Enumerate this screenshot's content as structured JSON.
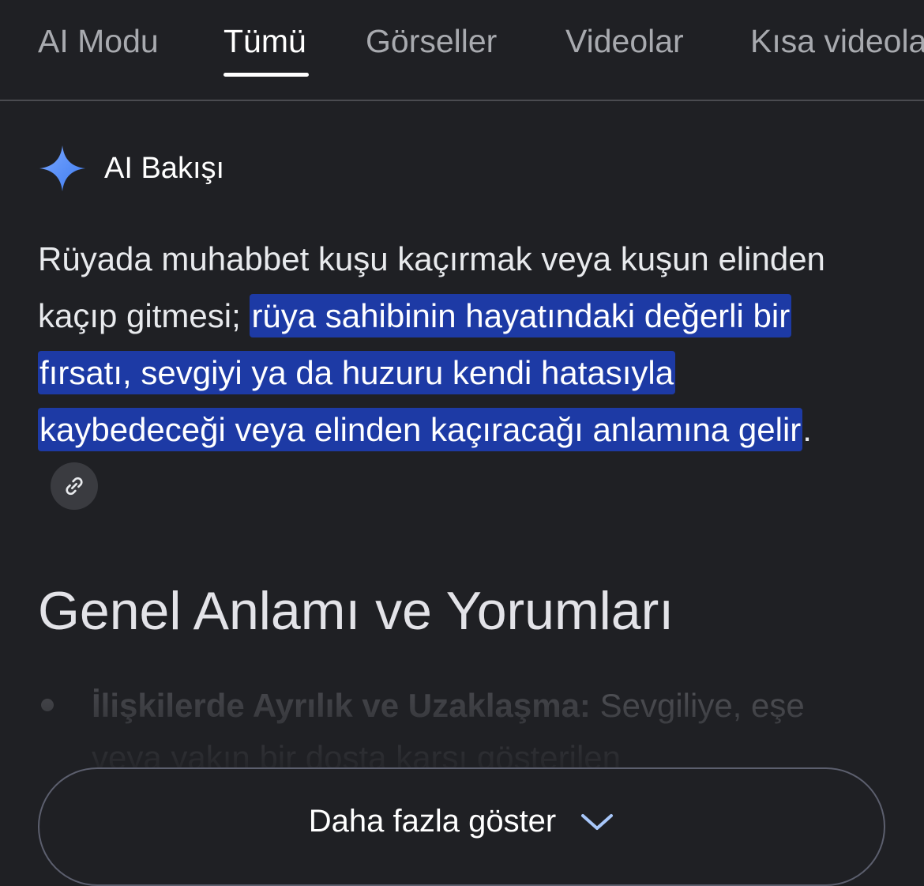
{
  "tabs": [
    {
      "label": "AI Modu",
      "active": false
    },
    {
      "label": "Tümü",
      "active": true
    },
    {
      "label": "Görseller",
      "active": false
    },
    {
      "label": "Videolar",
      "active": false
    },
    {
      "label": "Kısa videolar",
      "active": false
    }
  ],
  "ai_overview": {
    "title": "AI Bakışı",
    "icon": "sparkle-icon",
    "intro_text": "Rüyada muhabbet kuşu kaçırmak veya kuşun elinden kaçıp gitmesi; ",
    "highlighted_text": "rüya sahibinin hayatındaki değerli bir fırsatı, sevgiyi ya da huzuru kendi hatasıyla kaybedeceği veya elinden kaçıracağı anlamına gelir",
    "end_punctuation": ".",
    "link_icon": "link-icon"
  },
  "section": {
    "heading": "Genel Anlamı ve Yorumları",
    "bullet_title": "İlişkilerde Ayrılık ve Uzaklaşma:",
    "bullet_text": " Sevgiliye, eşe veya yakın bir dosta karşı gösterilen"
  },
  "show_more": {
    "label": "Daha fazla göster",
    "icon": "chevron-down-icon"
  },
  "colors": {
    "background": "#1f2024",
    "highlight": "#1d3aa5",
    "sparkle": "#4f8cf6"
  }
}
